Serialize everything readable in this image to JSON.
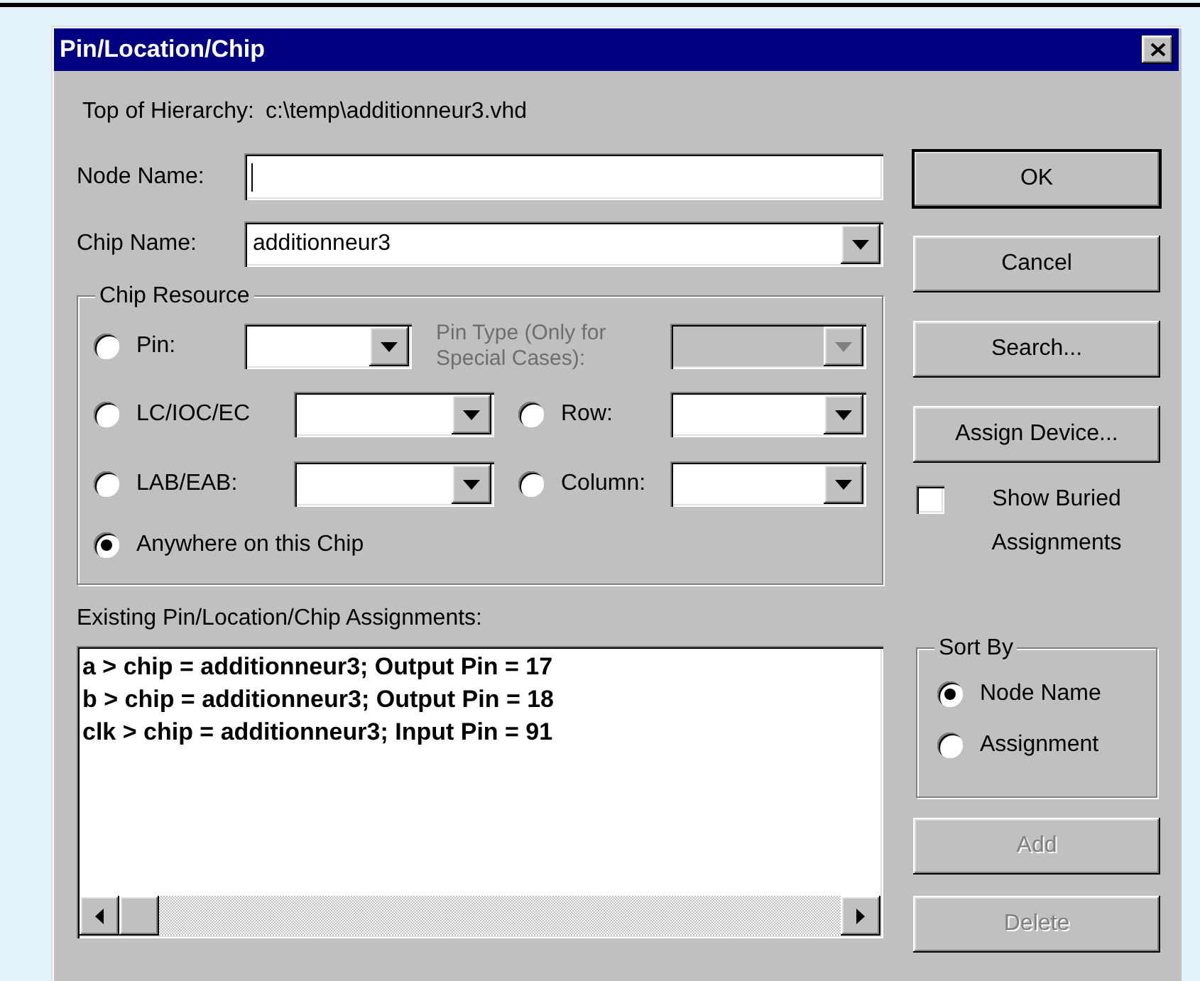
{
  "window": {
    "title": "Pin/Location/Chip"
  },
  "hierarchy": {
    "label": "Top of Hierarchy:",
    "value": "c:\\temp\\additionneur3.vhd"
  },
  "node_name": {
    "label": "Node Name:"
  },
  "chip_name": {
    "label": "Chip Name:",
    "value": "additionneur3"
  },
  "chip_resource": {
    "title": "Chip Resource",
    "options": [
      {
        "label": "Pin:",
        "selected": false
      },
      {
        "label": "LC/IOC/EC",
        "selected": false
      },
      {
        "label": "Row:",
        "selected": false
      },
      {
        "label": "LAB/EAB:",
        "selected": false
      },
      {
        "label": "Column:",
        "selected": false
      },
      {
        "label": "Anywhere on this Chip",
        "selected": true
      }
    ],
    "pin_type": {
      "label": "Pin Type (Only for Special Cases):",
      "disabled": true
    }
  },
  "assignments": {
    "label": "Existing Pin/Location/Chip Assignments:",
    "rows": [
      "a > chip = additionneur3; Output Pin = 17",
      "b > chip = additionneur3; Output Pin = 18",
      "clk > chip = additionneur3; Input Pin = 91"
    ]
  },
  "buttons_top": [
    {
      "label": "OK",
      "default": true,
      "disabled": false
    },
    {
      "label": "Cancel",
      "default": false,
      "disabled": false
    },
    {
      "label": "Search...",
      "default": false,
      "disabled": false
    },
    {
      "label": "Assign Device...",
      "default": false,
      "disabled": false
    }
  ],
  "show_buried": {
    "label": "Show Buried Assignments",
    "checked": false
  },
  "sort_by": {
    "title": "Sort By",
    "options": [
      {
        "label": "Node Name",
        "selected": true
      },
      {
        "label": "Assignment",
        "selected": false
      }
    ]
  },
  "buttons_bottom": [
    {
      "label": "Add",
      "default": false,
      "disabled": true
    },
    {
      "label": "Delete",
      "default": false,
      "disabled": true
    }
  ]
}
